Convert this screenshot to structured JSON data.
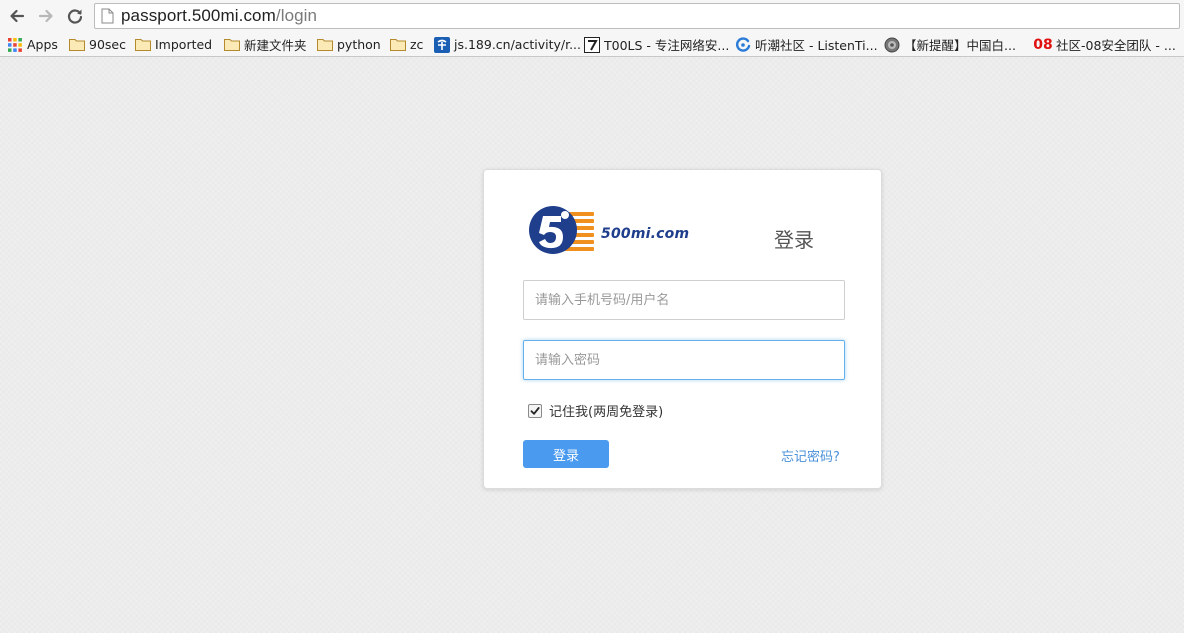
{
  "browser": {
    "url_host": "passport.500mi.com",
    "url_path": "/login"
  },
  "bookmarks": [
    {
      "label": "Apps",
      "icon": "apps-grid-icon"
    },
    {
      "label": "90sec",
      "icon": "folder-icon"
    },
    {
      "label": "Imported",
      "icon": "folder-icon"
    },
    {
      "label": "新建文件夹",
      "icon": "folder-icon"
    },
    {
      "label": "python",
      "icon": "folder-icon"
    },
    {
      "label": "zc",
      "icon": "folder-icon"
    },
    {
      "label": "js.189.cn/activity/r...",
      "icon": "telecom-icon"
    },
    {
      "label": "T00LS - 专注网络安...",
      "icon": "t00ls-icon"
    },
    {
      "label": "听潮社区 - ListenTi...",
      "icon": "listentide-icon"
    },
    {
      "label": "【新提醒】中国白...",
      "icon": "badge-icon"
    },
    {
      "label": "社区-08安全团队 - ...",
      "icon": "08-icon"
    }
  ],
  "bookmark_08_text": "08",
  "login": {
    "logo_text": "500mi.com",
    "title": "登录",
    "username_placeholder": "请输入手机号码/用户名",
    "password_placeholder": "请输入密码",
    "remember_label": "记住我(两周免登录)",
    "remember_checked": true,
    "submit_label": "登录",
    "forgot_label": "忘记密码?"
  },
  "colors": {
    "primary_button": "#4a9af0",
    "link": "#4a90d9",
    "logo_blue": "#1f3e8c",
    "logo_orange": "#f0901e"
  }
}
